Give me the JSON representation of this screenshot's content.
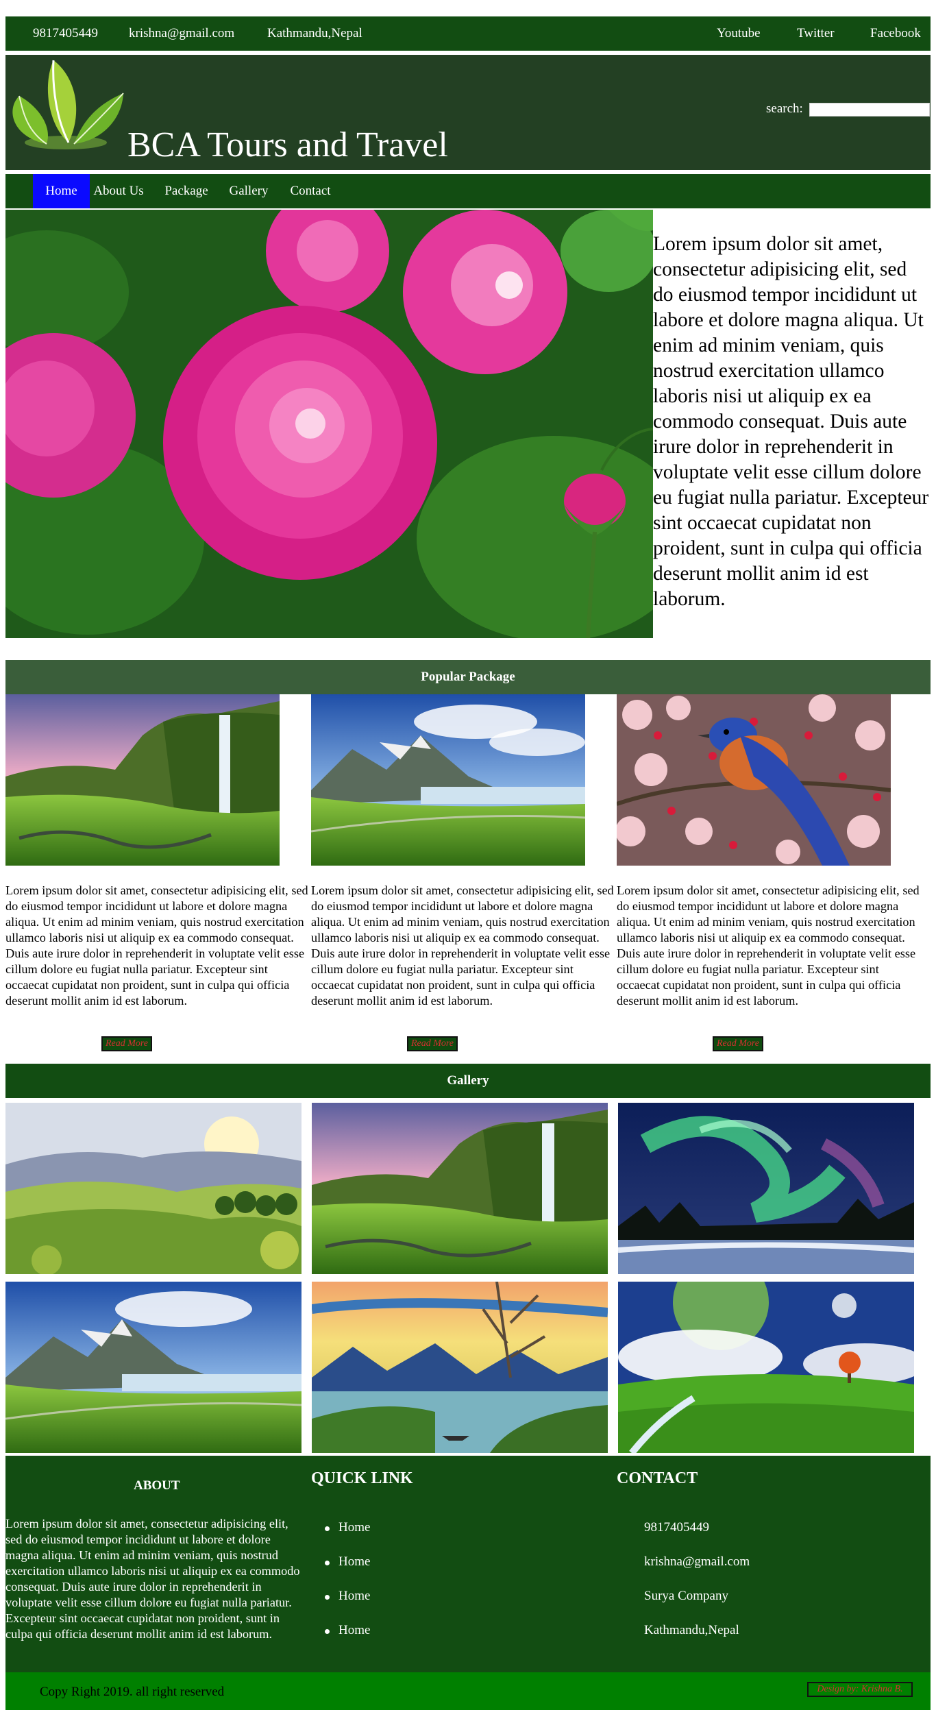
{
  "topbar": {
    "phone": "9817405449",
    "email": "krishna@gmail.com",
    "location": "Kathmandu,Nepal",
    "social": [
      "Youtube",
      "Twitter",
      "Facebook"
    ]
  },
  "header": {
    "title": "BCA Tours and Travel",
    "search_label": "search:",
    "search_value": ""
  },
  "nav": {
    "items": [
      "Home",
      "About Us",
      "Package",
      "Gallery",
      "Contact"
    ],
    "active": "Home"
  },
  "hero": {
    "image": "pink-roses",
    "text": "Lorem ipsum dolor sit amet, consectetur adipisicing elit, sed do eiusmod tempor incididunt ut labore et dolore magna aliqua. Ut enim ad minim veniam, quis nostrud exercitation ullamco laboris nisi ut aliquip ex ea commodo consequat. Duis aute irure dolor in reprehenderit in voluptate velit esse cillum dolore eu fugiat nulla pariatur. Excepteur sint occaecat cupidatat non proident, sunt in culpa qui officia deserunt mollit anim id est laborum."
  },
  "packages": {
    "heading": "Popular Package",
    "items": [
      {
        "image": "waterfall-valley",
        "text": "Lorem ipsum dolor sit amet, consectetur adipisicing elit, sed do eiusmod tempor incididunt ut labore et dolore magna aliqua. Ut enim ad minim veniam, quis nostrud exercitation ullamco laboris nisi ut aliquip ex ea commodo consequat. Duis aute irure dolor in reprehenderit in voluptate velit esse cillum dolore eu fugiat nulla pariatur. Excepteur sint occaecat cupidatat non proident, sunt in culpa qui officia deserunt mollit anim id est laborum.",
        "button": "Read More"
      },
      {
        "image": "mountain-lake",
        "text": "Lorem ipsum dolor sit amet, consectetur adipisicing elit, sed do eiusmod tempor incididunt ut labore et dolore magna aliqua. Ut enim ad minim veniam, quis nostrud exercitation ullamco laboris nisi ut aliquip ex ea commodo consequat. Duis aute irure dolor in reprehenderit in voluptate velit esse cillum dolore eu fugiat nulla pariatur. Excepteur sint occaecat cupidatat non proident, sunt in culpa qui officia deserunt mollit anim id est laborum.",
        "button": "Read More"
      },
      {
        "image": "bluebird-blossoms",
        "text": "Lorem ipsum dolor sit amet, consectetur adipisicing elit, sed do eiusmod tempor incididunt ut labore et dolore magna aliqua. Ut enim ad minim veniam, quis nostrud exercitation ullamco laboris nisi ut aliquip ex ea commodo consequat. Duis aute irure dolor in reprehenderit in voluptate velit esse cillum dolore eu fugiat nulla pariatur. Excepteur sint occaecat cupidatat non proident, sunt in culpa qui officia deserunt mollit anim id est laborum.",
        "button": "Read More"
      }
    ]
  },
  "gallery": {
    "heading": "Gallery",
    "images": [
      "rolling-hills",
      "waterfall-valley",
      "aurora-lake",
      "mountain-lake",
      "painted-lake",
      "green-field-moon"
    ]
  },
  "footer": {
    "about": {
      "heading": "ABOUT",
      "text": "Lorem ipsum dolor sit amet, consectetur adipisicing elit, sed do eiusmod tempor incididunt ut labore et dolore magna aliqua. Ut enim ad minim veniam, quis nostrud exercitation ullamco laboris nisi ut aliquip ex ea commodo consequat. Duis aute irure dolor in reprehenderit in voluptate velit esse cillum dolore eu fugiat nulla pariatur. Excepteur sint occaecat cupidatat non proident, sunt in culpa qui officia deserunt mollit anim id est laborum."
    },
    "quick_links": {
      "heading": "QUICK LINK",
      "items": [
        "Home",
        "Home",
        "Home",
        "Home"
      ]
    },
    "contact": {
      "heading": "CONTACT",
      "items": [
        "9817405449",
        "krishna@gmail.com",
        "Surya Company",
        "Kathmandu,Nepal"
      ]
    },
    "copyright": "Copy Right 2019. all right reserved",
    "credit": "Design by: Krishna B."
  },
  "colors": {
    "dark_green": "#124d12",
    "header_green": "#234023",
    "section_green": "#3a5e3a",
    "bright_green": "#008000",
    "active_nav": "#0a0aff",
    "button_text": "#d43030"
  }
}
